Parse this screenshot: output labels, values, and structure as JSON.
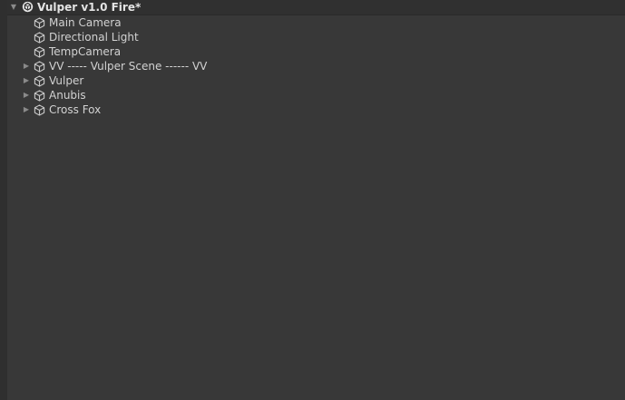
{
  "hierarchy": {
    "scene": {
      "name": "Vulper v1.0 Fire*",
      "expanded": true,
      "icon": "unity-scene-icon"
    },
    "items": [
      {
        "label": "Main Camera",
        "has_children": false,
        "icon": "gameobject-cube-icon"
      },
      {
        "label": "Directional Light",
        "has_children": false,
        "icon": "gameobject-cube-icon"
      },
      {
        "label": "TempCamera",
        "has_children": false,
        "icon": "gameobject-cube-icon"
      },
      {
        "label": "VV ----- Vulper Scene ------ VV",
        "has_children": true,
        "expanded": false,
        "icon": "gameobject-cube-icon"
      },
      {
        "label": "Vulper",
        "has_children": true,
        "expanded": false,
        "icon": "gameobject-cube-icon"
      },
      {
        "label": "Anubis",
        "has_children": true,
        "expanded": false,
        "icon": "gameobject-cube-icon"
      },
      {
        "label": "Cross Fox",
        "has_children": true,
        "expanded": false,
        "icon": "gameobject-cube-icon"
      }
    ]
  },
  "colors": {
    "background": "#383838",
    "scene_header": "#303030",
    "text": "#d2d2d2",
    "fold_arrow": "#8a8a8a"
  }
}
